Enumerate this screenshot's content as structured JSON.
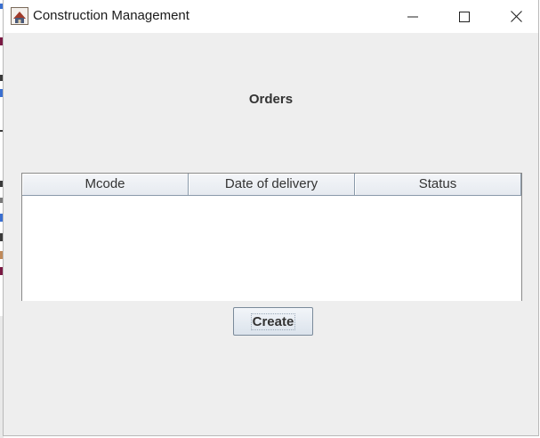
{
  "window": {
    "title": "Construction Management",
    "controls": {
      "minimize": "minimize-icon",
      "maximize": "maximize-icon",
      "close": "close-icon"
    }
  },
  "main": {
    "heading": "Orders",
    "table": {
      "columns": [
        "Mcode",
        "Date of delivery",
        "Status"
      ],
      "rows": []
    },
    "create_label": "Create"
  },
  "colors": {
    "window_bg": "#eeeeee",
    "titlebar_bg": "#ffffff",
    "table_header_bg": "#eef1f5",
    "button_bg": "#dbe3ec"
  }
}
